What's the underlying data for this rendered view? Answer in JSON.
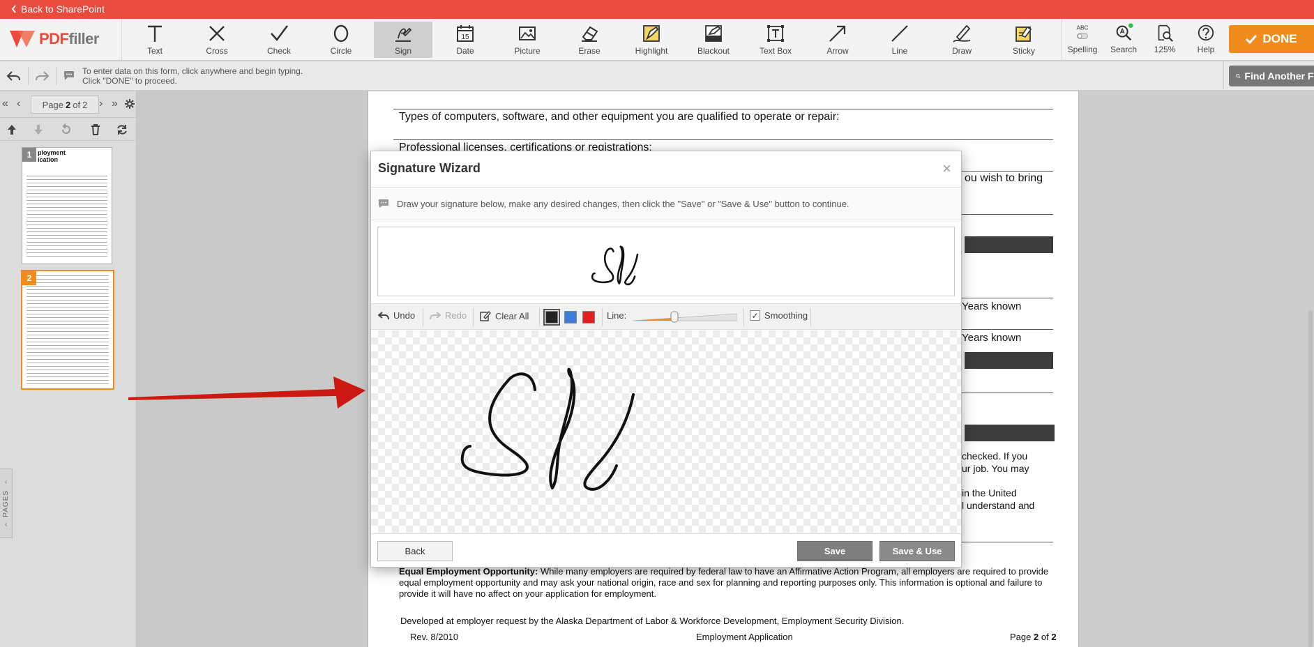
{
  "topbar": {
    "back_label": "Back to SharePoint"
  },
  "logo": {
    "brand_pdf": "PDF",
    "brand_rest": "filler"
  },
  "toolbar": {
    "tools": [
      {
        "label": "Text",
        "icon": "text-icon"
      },
      {
        "label": "Cross",
        "icon": "cross-icon"
      },
      {
        "label": "Check",
        "icon": "check-icon"
      },
      {
        "label": "Circle",
        "icon": "circle-icon"
      },
      {
        "label": "Sign",
        "icon": "sign-icon"
      },
      {
        "label": "Date",
        "icon": "date-icon"
      },
      {
        "label": "Picture",
        "icon": "picture-icon"
      },
      {
        "label": "Erase",
        "icon": "erase-icon"
      },
      {
        "label": "Highlight",
        "icon": "highlight-icon"
      },
      {
        "label": "Blackout",
        "icon": "blackout-icon"
      },
      {
        "label": "Text Box",
        "icon": "text-box-icon"
      },
      {
        "label": "Arrow",
        "icon": "arrow-icon"
      },
      {
        "label": "Line",
        "icon": "line-icon"
      },
      {
        "label": "Draw",
        "icon": "draw-icon"
      },
      {
        "label": "Sticky",
        "icon": "sticky-icon"
      }
    ],
    "active_tool": "Sign",
    "date_icon_number": "15",
    "right_tools": [
      {
        "label": "Spelling",
        "icon": "spelling-icon",
        "sub": "ABC"
      },
      {
        "label": "Search",
        "icon": "search-icon"
      },
      {
        "label": "125%",
        "icon": "zoom-icon"
      },
      {
        "label": "Help",
        "icon": "help-icon"
      }
    ],
    "done_label": "DONE"
  },
  "infobar": {
    "line1": "To enter data on this form, click anywhere and begin typing.",
    "line2": "Click \"DONE\" to proceed.",
    "find_label": "Find Another Fo"
  },
  "pages_panel": {
    "page_prefix": "Page",
    "current_page": "2",
    "page_of": "of",
    "total_pages": "2",
    "thumbs": [
      {
        "num": "1",
        "title_line1": "ployment",
        "title_line2": "ication"
      },
      {
        "num": "2"
      }
    ],
    "tab_label": "PAGES"
  },
  "document": {
    "line_computers": "Types of computers, software, and other equipment you are qualified to operate or repair:",
    "line_licenses": "Professional licenses, certifications or registrations:",
    "frag_bring": "ou wish to bring",
    "frag_years1": "Years known",
    "frag_years2": "Years known",
    "frag_checked": "checked. If you",
    "frag_job": "ur job. You may",
    "frag_united": "in the United",
    "frag_understand": "l understand and",
    "eeo_bold": "Equal Employment Opportunity:",
    "eeo_text": " While many employers are required by federal law to have an Affirmative Action Program, all employers are required to provide equal employment opportunity and may ask your national origin, race and sex for planning and reporting purposes only. This information is optional and failure to provide it will have no affect on your application for employment.",
    "developed": "Developed at employer request by the Alaska Department of Labor & Workforce Development, Employment Security Division.",
    "rev": "Rev. 8/2010",
    "footer_title": "Employment Application",
    "footer_page_prefix": "Page",
    "footer_page": "2",
    "footer_of": "of",
    "footer_total": "2"
  },
  "modal": {
    "title": "Signature Wizard",
    "close": "×",
    "info": "Draw your signature below, make any desired changes, then click the \"Save\" or \"Save & Use\" button to continue.",
    "tools": {
      "undo": "Undo",
      "redo": "Redo",
      "clear_all": "Clear All",
      "line_label": "Line:",
      "smoothing": "Smoothing"
    },
    "colors": [
      "#222222",
      "#3b7dd8",
      "#e02020"
    ],
    "selected_color": "#222222",
    "line_value_fraction": 0.4,
    "smoothing_checked": true,
    "buttons": {
      "back": "Back",
      "save": "Save",
      "save_use": "Save & Use"
    }
  }
}
